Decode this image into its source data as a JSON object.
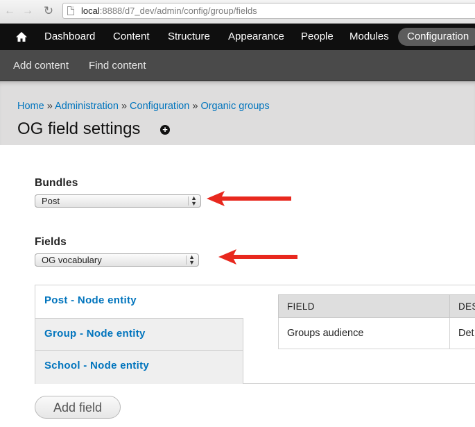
{
  "browser": {
    "url_host": "local",
    "url_rest": ":8888/d7_dev/admin/config/group/fields"
  },
  "toolbar": {
    "items": [
      "Dashboard",
      "Content",
      "Structure",
      "Appearance",
      "People",
      "Modules"
    ],
    "active": "Configuration"
  },
  "shortcuts": {
    "items": [
      "Add content",
      "Find content"
    ]
  },
  "breadcrumb": {
    "items": [
      "Home",
      "Administration",
      "Configuration",
      "Organic groups"
    ],
    "separator": "»"
  },
  "page": {
    "title": "OG field settings"
  },
  "form": {
    "bundles_label": "Bundles",
    "bundles_value": "Post",
    "fields_label": "Fields",
    "fields_value": "OG vocabulary",
    "add_button": "Add field"
  },
  "tabs": [
    {
      "label": "Post - Node entity",
      "active": true
    },
    {
      "label": "Group - Node entity",
      "active": false
    },
    {
      "label": "School - Node entity",
      "active": false
    }
  ],
  "table": {
    "headers": [
      "FIELD",
      "DES"
    ],
    "rows": [
      [
        "Groups audience",
        "Det"
      ]
    ]
  },
  "colors": {
    "link": "#0074bd",
    "toolbar": "#0f0f0f",
    "annotation_arrow": "#e8281e"
  }
}
